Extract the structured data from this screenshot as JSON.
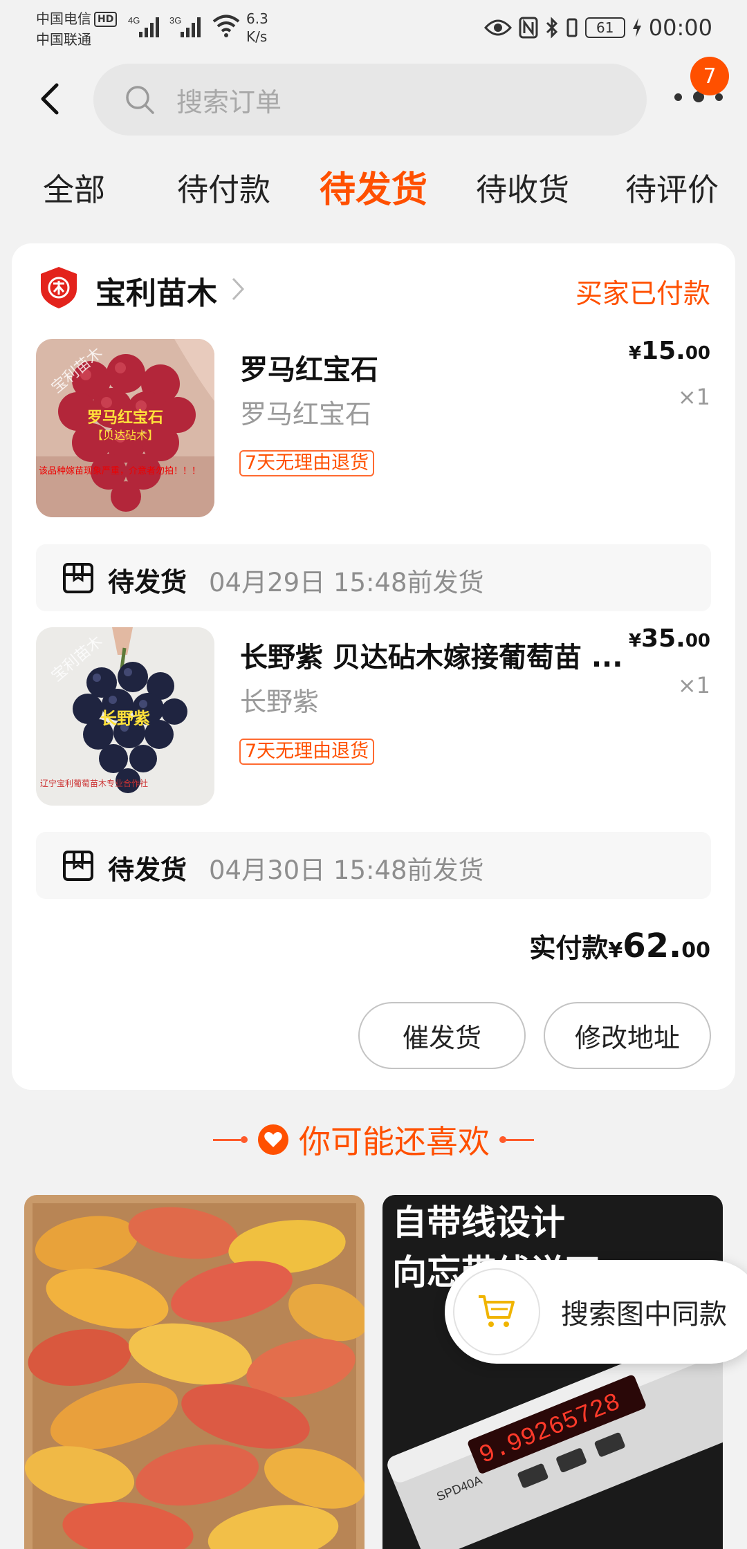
{
  "status_bar": {
    "carrier1": "中国电信",
    "hd": "HD",
    "carrier2": "中国联通",
    "net1": "4G",
    "net2": "3G",
    "speed_value": "6.3",
    "speed_unit": "K/s",
    "battery": "61",
    "time": "00:00"
  },
  "header": {
    "search_placeholder": "搜索订单",
    "notification_count": "7"
  },
  "tabs": [
    {
      "label": "全部",
      "active": false
    },
    {
      "label": "待付款",
      "active": false
    },
    {
      "label": "待发货",
      "active": true
    },
    {
      "label": "待收货",
      "active": false
    },
    {
      "label": "待评价",
      "active": false
    }
  ],
  "order": {
    "shop_name": "宝利苗木",
    "status": "买家已付款",
    "items": [
      {
        "title": "罗马红宝石",
        "spec": "罗马红宝石",
        "price_symbol": "¥",
        "price_int": "15.",
        "price_dec": "00",
        "qty": "×1",
        "tag": "7天无理由退货",
        "thumb_watermark": "宝利苗木",
        "thumb_label": "罗马红宝石",
        "thumb_sub": "【贝达砧木】",
        "thumb_note": "该品种嫁苗现象严重，介意者勿拍！！！",
        "ship_status": "待发货",
        "ship_deadline": "04月29日 15:48前发货"
      },
      {
        "title": "长野紫  贝达砧木嫁接葡萄苗 ...",
        "spec": "长野紫",
        "price_symbol": "¥",
        "price_int": "35.",
        "price_dec": "00",
        "qty": "×1",
        "tag": "7天无理由退货",
        "thumb_watermark": "宝利苗木",
        "thumb_label": "长野紫",
        "thumb_note": "辽宁宝利葡萄苗木专业合作社",
        "ship_status": "待发货",
        "ship_deadline": "04月30日 15:48前发货"
      }
    ],
    "total_label": "实付款",
    "total_symbol": "¥",
    "total_int": "62.",
    "total_dec": "00",
    "buttons": {
      "urge": "催发货",
      "address": "修改地址"
    }
  },
  "recommend": {
    "title": "你可能还喜欢",
    "right_text_line1": "自带线设计",
    "right_text_line2": "向忘带线说不",
    "device_label": "SPD40A",
    "device_readout": "9.99265728"
  },
  "float_search": {
    "label": "搜索图中同款"
  },
  "colors": {
    "accent": "#ff5000",
    "page_bg": "#f2f2f2",
    "card_bg": "#ffffff",
    "muted_text": "#9a9a9a"
  },
  "icons": {
    "back": "chevron-left-icon",
    "search": "search-icon",
    "more": "more-dots-icon",
    "shop": "shop-shield-icon",
    "shop_arrow": "chevron-right-icon",
    "ship": "package-icon",
    "favorite": "heart-icon",
    "cart": "cart-icon"
  }
}
